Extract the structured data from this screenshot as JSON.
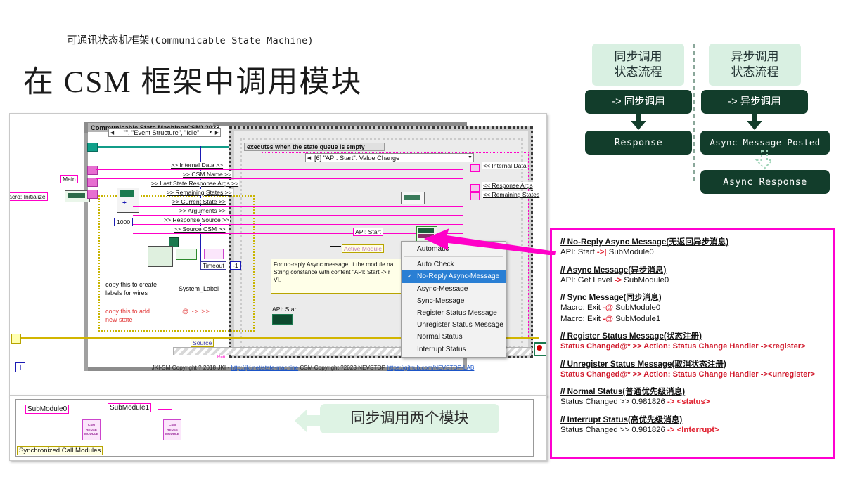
{
  "slide": {
    "subtitle_cn": "可通讯状态机框架",
    "subtitle_en": "(Communicable State Machine)",
    "title": "在 CSM 框架中调用模块"
  },
  "flow": {
    "sync": {
      "head_line1": "同步调用",
      "head_line2": "状态流程",
      "step1": "-> 同步调用",
      "step2": "Response"
    },
    "async": {
      "head_line1": "异步调用",
      "head_line2": "状态流程",
      "step1": "-> 异步调用",
      "step2": "Async Message Posted",
      "step3": "Async Response"
    }
  },
  "legend": {
    "border_color": "#ff00d0",
    "groups": [
      {
        "header": "// No-Reply Async Message(无返回异步消息)",
        "lines": [
          {
            "pre": "API: Start ",
            "mark": "->|",
            "post": " SubModule0",
            "style": "normal"
          }
        ]
      },
      {
        "header": "// Async Message(异步消息)",
        "lines": [
          {
            "pre": "API: Get Level ",
            "mark": "->",
            "post": " SubModule0",
            "style": "normal"
          }
        ]
      },
      {
        "header": "// Sync Message(同步消息)",
        "lines": [
          {
            "pre": "Macro: Exit ",
            "mark": "-@",
            "post": " SubModule0",
            "style": "normal"
          },
          {
            "pre": "Macro: Exit ",
            "mark": "-@",
            "post": " SubModule1",
            "style": "normal"
          }
        ]
      },
      {
        "header": "// Register Status Message(状态注册)",
        "lines": [
          {
            "pre": "Status Changed@* >> Action: Status Change Handler -><register>",
            "mark": "",
            "post": "",
            "style": "red"
          }
        ]
      },
      {
        "header": "// Unregister Status Message(取消状态注册)",
        "lines": [
          {
            "pre": "Status Changed@* >> Action: Status Change Handler -><unregister>",
            "mark": "",
            "post": "",
            "style": "red"
          }
        ]
      },
      {
        "header": "// Normal Status(普通优先级消息)",
        "lines": [
          {
            "pre": "Status Changed >> 0.981826 ",
            "mark": "-> <status>",
            "post": "",
            "style": "normal"
          }
        ]
      },
      {
        "header": "// Interrupt Status(高优先级消息)",
        "lines": [
          {
            "pre": "Status Changed >> 0.981826 ",
            "mark": "-> <Interrupt>",
            "post": "",
            "style": "normal"
          }
        ]
      }
    ]
  },
  "diagram": {
    "csm_title": "Communicable State Machine(CSM) 2023",
    "event_selector": "\"\", \"Event Structure\", \"Idle\"",
    "case_banner": "executes when the state queue is empty",
    "event_case": "[6] \"API: Start\": Value Change",
    "timeout_label": "Timeout",
    "timeout_value": "-1",
    "constant_1000": "1000",
    "label_main": "Main",
    "label_macro_init": "Macro: Initialize",
    "wire_labels_center": [
      ">> Internal Data >>",
      ">> CSM Name >>",
      ">> Last State Response Args >>",
      ">> Remaining States >>",
      ">> Current State >>",
      ">> Arguments >>",
      ">> Response Source >>",
      ">> Source CSM >>"
    ],
    "wire_labels_right": [
      "<< Internal Data",
      "<< Response Args",
      "<< Remaining States"
    ],
    "notes": {
      "copy_labels": "copy this to create\nlabels for wires",
      "copy_state": "copy this to add\nnew state",
      "system_label": "System_Label",
      "symbols": "@    ->    >>"
    },
    "comment_box": "For no-reply Async message, if the module na\nString constance with content \"API: Start -> r\nVI.",
    "api_start_label": "API: Start",
    "active_module_label": "Active Module",
    "source_label": "Source",
    "copyright": {
      "pre": "JKI-SM Copyright ? 2018 JKI - ",
      "link1": "http://jki.net/state-machine",
      "mid": " CSM Copyright ?2023 NEVSTOP ",
      "link2": "https://github.com/NEVSTOP-LAB"
    }
  },
  "menu": {
    "items": [
      {
        "label": "Automatic",
        "selected": false,
        "checked": false
      },
      {
        "label": "Auto Check",
        "selected": false,
        "checked": false
      },
      {
        "label": "No-Reply Async-Message",
        "selected": true,
        "checked": true
      },
      {
        "label": "Async-Message",
        "selected": false,
        "checked": false
      },
      {
        "label": "Sync-Message",
        "selected": false,
        "checked": false
      },
      {
        "label": "Register Status Message",
        "selected": false,
        "checked": false
      },
      {
        "label": "Unregister Status Message",
        "selected": false,
        "checked": false
      },
      {
        "label": "Normal Status",
        "selected": false,
        "checked": false
      },
      {
        "label": "Interrupt Status",
        "selected": false,
        "checked": false
      }
    ]
  },
  "bottom_panel": {
    "sub0": "SubModule0",
    "sub1": "SubModule1",
    "reuse_block": "CSM\nREUSE\nMODULE",
    "frame_label": "Synchronized Call Modules",
    "callout": "同步调用两个模块"
  }
}
